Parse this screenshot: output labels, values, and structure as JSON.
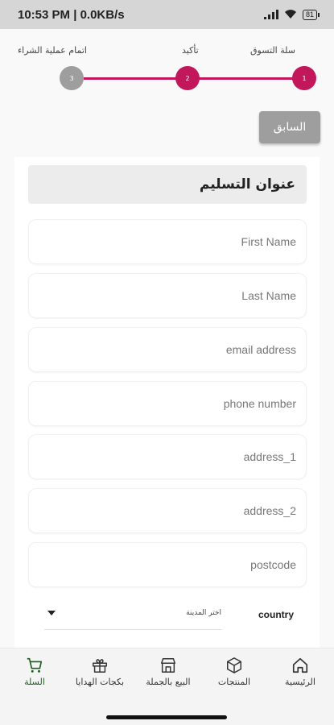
{
  "status_bar": {
    "time": "10:53 PM | 0.0KB/s",
    "battery": "81"
  },
  "stepper": {
    "steps": [
      {
        "label": "سلة التسوق",
        "number": "1",
        "state": "active"
      },
      {
        "label": "تأكيد",
        "number": "2",
        "state": "active"
      },
      {
        "label": "اتمام عملية الشراء",
        "number": "3",
        "state": "inactive"
      }
    ],
    "accent_color": "#c2185b",
    "inactive_color": "#9e9e9e"
  },
  "previous_button": "السابق",
  "form": {
    "section_title": "عنوان التسليم",
    "fields": {
      "first_name": {
        "placeholder": "First Name",
        "value": ""
      },
      "last_name": {
        "placeholder": "Last Name",
        "value": ""
      },
      "email": {
        "placeholder": "email address",
        "value": ""
      },
      "phone": {
        "placeholder": "phone number",
        "value": ""
      },
      "address_1": {
        "placeholder": "address_1",
        "value": ""
      },
      "address_2": {
        "placeholder": "address_2",
        "value": ""
      },
      "postcode": {
        "placeholder": "postcode",
        "value": ""
      }
    },
    "country_label": "country",
    "city_select_value": "اختر المدينة"
  },
  "bottom_nav": {
    "items": [
      {
        "label": "الرئيسية",
        "icon": "home-icon"
      },
      {
        "label": "المنتجات",
        "icon": "box-icon"
      },
      {
        "label": "البيع بالجملة",
        "icon": "store-icon"
      },
      {
        "label": "بكجات الهدايا",
        "icon": "gift-icon"
      },
      {
        "label": "السلة",
        "icon": "cart-icon",
        "active": true
      }
    ],
    "active_color": "#1b5e20"
  }
}
